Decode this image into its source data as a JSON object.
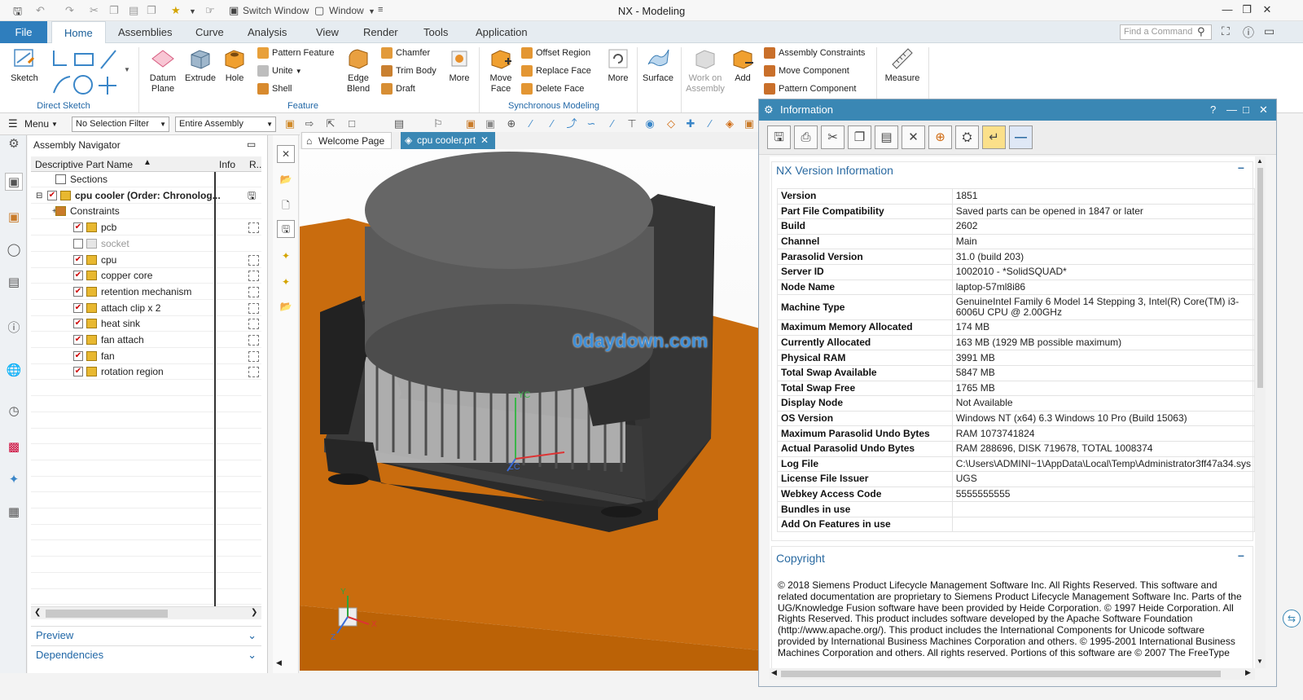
{
  "app": {
    "title": "NX - Modeling",
    "quick_access": {
      "switch_window": "Switch Window",
      "window": "Window"
    }
  },
  "menu_tabs": {
    "file": "File",
    "tabs": [
      "Home",
      "Assemblies",
      "Curve",
      "Analysis",
      "View",
      "Render",
      "Tools",
      "Application"
    ],
    "search_placeholder": "Find a Command"
  },
  "ribbon": {
    "direct_sketch": {
      "sketch": "Sketch",
      "group": "Direct Sketch"
    },
    "feature": {
      "datum_plane": "Datum Plane",
      "extrude": "Extrude",
      "hole": "Hole",
      "pattern_feature": "Pattern Feature",
      "unite": "Unite",
      "shell": "Shell",
      "edge_blend": "Edge Blend",
      "chamfer": "Chamfer",
      "trim_body": "Trim Body",
      "draft": "Draft",
      "more": "More",
      "group": "Feature"
    },
    "synchronous": {
      "move_face": "Move Face",
      "offset_region": "Offset Region",
      "replace_face": "Replace Face",
      "delete_face": "Delete Face",
      "more": "More",
      "group": "Synchronous Modeling"
    },
    "surface": "Surface",
    "assembly": {
      "work_on_assembly": "Work on Assembly",
      "add": "Add",
      "assembly_constraints": "Assembly Constraints",
      "move_component": "Move Component",
      "pattern_component": "Pattern Component",
      "group": "As"
    },
    "measure": "Measure"
  },
  "selection_bar": {
    "menu": "Menu",
    "filter": "No Selection Filter",
    "scope": "Entire Assembly"
  },
  "navigator": {
    "title": "Assembly Navigator",
    "columns": {
      "name": "Descriptive Part Name",
      "info": "Info",
      "r": "R.."
    },
    "rows": [
      {
        "label": "Sections",
        "checked": false,
        "level": 1
      },
      {
        "label": "cpu cooler (Order: Chronolog...",
        "checked": true,
        "level": 0
      },
      {
        "label": "Constraints",
        "checked": false,
        "level": 1
      },
      {
        "label": "pcb",
        "checked": true,
        "level": 2
      },
      {
        "label": "socket",
        "checked": false,
        "level": 2
      },
      {
        "label": "cpu",
        "checked": true,
        "level": 2
      },
      {
        "label": "copper core",
        "checked": true,
        "level": 2
      },
      {
        "label": "retention mechanism",
        "checked": true,
        "level": 2
      },
      {
        "label": "attach clip x 2",
        "checked": true,
        "level": 2
      },
      {
        "label": "heat sink",
        "checked": true,
        "level": 2
      },
      {
        "label": "fan attach",
        "checked": true,
        "level": 2
      },
      {
        "label": "fan",
        "checked": true,
        "level": 2
      },
      {
        "label": "rotation region",
        "checked": true,
        "level": 2
      }
    ],
    "preview": "Preview",
    "dependencies": "Dependencies"
  },
  "doc_tabs": {
    "welcome": "Welcome Page",
    "active": "cpu cooler.prt"
  },
  "viewport": {
    "watermark": "0daydown.com",
    "axes": {
      "yc": "YC",
      "zc": "ZC",
      "x": "X",
      "y": "Y",
      "z": "Z"
    }
  },
  "info_window": {
    "title": "Information",
    "version_section": "NX Version Information",
    "rows": [
      [
        "Version",
        "1851"
      ],
      [
        "Part File Compatibility",
        "Saved parts can be opened in 1847 or later"
      ],
      [
        "Build",
        "2602"
      ],
      [
        "Channel",
        "Main"
      ],
      [
        "Parasolid Version",
        "31.0 (build 203)"
      ],
      [
        "Server ID",
        "1002010 - *SolidSQUAD*"
      ],
      [
        "Node Name",
        "laptop-57ml8i86"
      ],
      [
        "Machine Type",
        "GenuineIntel Family 6 Model 14 Stepping 3, Intel(R) Core(TM) i3-6006U CPU @ 2.00GHz"
      ],
      [
        "Maximum Memory Allocated",
        "174 MB"
      ],
      [
        "Currently Allocated",
        "163 MB (1929 MB possible maximum)"
      ],
      [
        "Physical RAM",
        "3991 MB"
      ],
      [
        "Total Swap Available",
        "5847 MB"
      ],
      [
        "Total Swap Free",
        "1765 MB"
      ],
      [
        "Display Node",
        "Not Available"
      ],
      [
        "OS Version",
        "Windows NT (x64) 6.3 Windows 10 Pro (Build 15063)"
      ],
      [
        "Maximum Parasolid Undo Bytes",
        "RAM 1073741824"
      ],
      [
        "Actual Parasolid Undo Bytes",
        "RAM 288696, DISK 719678, TOTAL 1008374"
      ],
      [
        "Log File",
        "C:\\Users\\ADMINI~1\\AppData\\Local\\Temp\\Administrator3ff47a34.sys"
      ],
      [
        "License File Issuer",
        "UGS"
      ],
      [
        "Webkey Access Code",
        "5555555555"
      ],
      [
        "Bundles in use",
        ""
      ],
      [
        "Add On Features in use",
        ""
      ]
    ],
    "copyright_section": "Copyright",
    "copyright_text": "© 2018 Siemens Product Lifecycle Management Software Inc. All Rights Reserved. This software and related documentation are proprietary to Siemens Product Lifecycle Management Software Inc. Parts of the UG/Knowledge Fusion software have been provided by Heide Corporation. © 1997 Heide Corporation. All Rights Reserved. This product includes software developed by the Apache Software Foundation (http://www.apache.org/). This product includes the International Components for Unicode software provided by International Business Machines Corporation and others. © 1995-2001 International Business Machines Corporation and others. All rights reserved. Portions of this software are © 2007 The FreeType"
  },
  "colors": {
    "accent": "#2f7ebd",
    "info_title": "#3a87b4",
    "floor": "#c46a0e",
    "model": "#3a3a3a"
  }
}
